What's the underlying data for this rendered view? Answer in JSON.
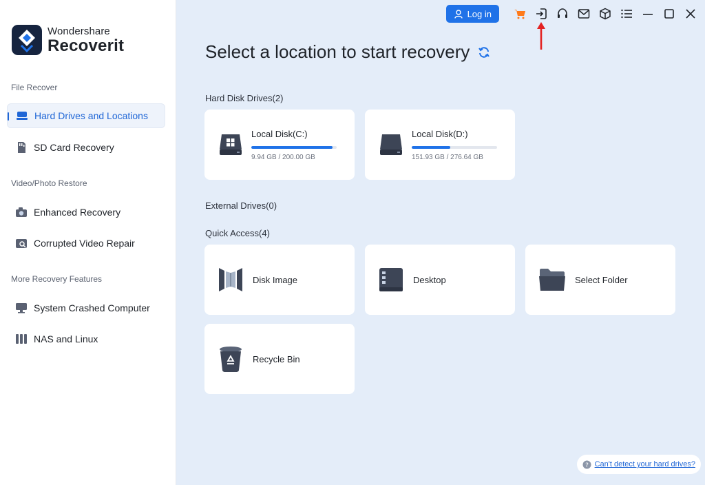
{
  "brand": {
    "name_small": "Wondershare",
    "name_big": "Recoverit"
  },
  "sidebar": {
    "sections": [
      {
        "label": "File Recover",
        "items": [
          {
            "label": "Hard Drives and Locations",
            "icon": "hard-drive-icon",
            "active": true
          },
          {
            "label": "SD Card Recovery",
            "icon": "sd-card-icon"
          }
        ]
      },
      {
        "label": "Video/Photo Restore",
        "items": [
          {
            "label": "Enhanced Recovery",
            "icon": "camera-icon"
          },
          {
            "label": "Corrupted Video Repair",
            "icon": "video-repair-icon"
          }
        ]
      },
      {
        "label": "More Recovery Features",
        "items": [
          {
            "label": "System Crashed Computer",
            "icon": "monitor-icon"
          },
          {
            "label": "NAS and Linux",
            "icon": "nas-icon"
          }
        ]
      }
    ]
  },
  "topbar": {
    "login_label": "Log in",
    "icons": [
      "cart-icon",
      "sign-in-icon",
      "headset-icon",
      "mail-icon",
      "cube-icon",
      "menu-icon",
      "minimize-icon",
      "maximize-icon",
      "close-icon"
    ]
  },
  "main": {
    "title": "Select a location to start recovery",
    "hard_disk_label": "Hard Disk Drives(2)",
    "drives": [
      {
        "name": "Local Disk(C:)",
        "size": "9.94 GB / 200.00 GB",
        "used_fraction": 0.95,
        "icon": "windows-drive-icon"
      },
      {
        "name": "Local Disk(D:)",
        "size": "151.93 GB / 276.64 GB",
        "used_fraction": 0.45,
        "icon": "drive-icon"
      }
    ],
    "external_label": "External Drives(0)",
    "quick_access_label": "Quick Access(4)",
    "quick_access": [
      {
        "label": "Disk Image",
        "icon": "disk-image-icon"
      },
      {
        "label": "Desktop",
        "icon": "desktop-icon"
      },
      {
        "label": "Select Folder",
        "icon": "folder-icon"
      },
      {
        "label": "Recycle Bin",
        "icon": "recycle-bin-icon"
      }
    ],
    "help_link": "Can't detect your hard drives?"
  },
  "colors": {
    "accent": "#1f72e8",
    "main_bg": "#e4edf9",
    "cart": "#ff7a1a",
    "annotation": "#e32222"
  }
}
